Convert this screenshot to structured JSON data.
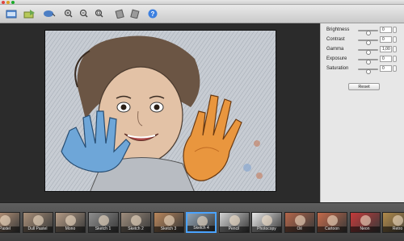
{
  "toolbar": {
    "buttons": [
      {
        "name": "open-image-icon"
      },
      {
        "name": "export-icon"
      },
      {
        "name": "share-icon"
      },
      {
        "name": "zoom-in-icon"
      },
      {
        "name": "zoom-out-icon"
      },
      {
        "name": "zoom-fit-icon"
      },
      {
        "name": "rotate-left-icon"
      },
      {
        "name": "rotate-right-icon"
      },
      {
        "name": "help-icon"
      }
    ]
  },
  "adjustments": {
    "brightness": {
      "label": "Brightness",
      "value": "0",
      "level": 0.5
    },
    "contrast": {
      "label": "Contrast",
      "value": "0",
      "level": 0.5
    },
    "gamma": {
      "label": "Gamma",
      "value": "1,00",
      "level": 0.5
    },
    "exposure": {
      "label": "Exposure",
      "value": "0",
      "level": 0.5
    },
    "saturation": {
      "label": "Saturation",
      "value": "0",
      "level": 0.5
    },
    "reset_label": "Reset"
  },
  "filters": [
    {
      "label": "Pastel",
      "color": "#c9a080"
    },
    {
      "label": "Dull Pastel",
      "color": "#a98f78"
    },
    {
      "label": "Mono",
      "color": "#b39a84"
    },
    {
      "label": "Sketch 1",
      "color": "#8d8d8d"
    },
    {
      "label": "Sketch 2",
      "color": "#9d8c7c"
    },
    {
      "label": "Sketch 3",
      "color": "#b9865b"
    },
    {
      "label": "Sketch 4",
      "color": "#8fa2b3",
      "selected": true
    },
    {
      "label": "Pencil",
      "color": "#d2d2d2"
    },
    {
      "label": "Photocopy",
      "color": "#e8e8e8"
    },
    {
      "label": "Oil",
      "color": "#b4664a"
    },
    {
      "label": "Cartoon",
      "color": "#c56a4a"
    },
    {
      "label": "Neon",
      "color": "#c43a3a"
    },
    {
      "label": "Retro",
      "color": "#b18a4a"
    }
  ]
}
